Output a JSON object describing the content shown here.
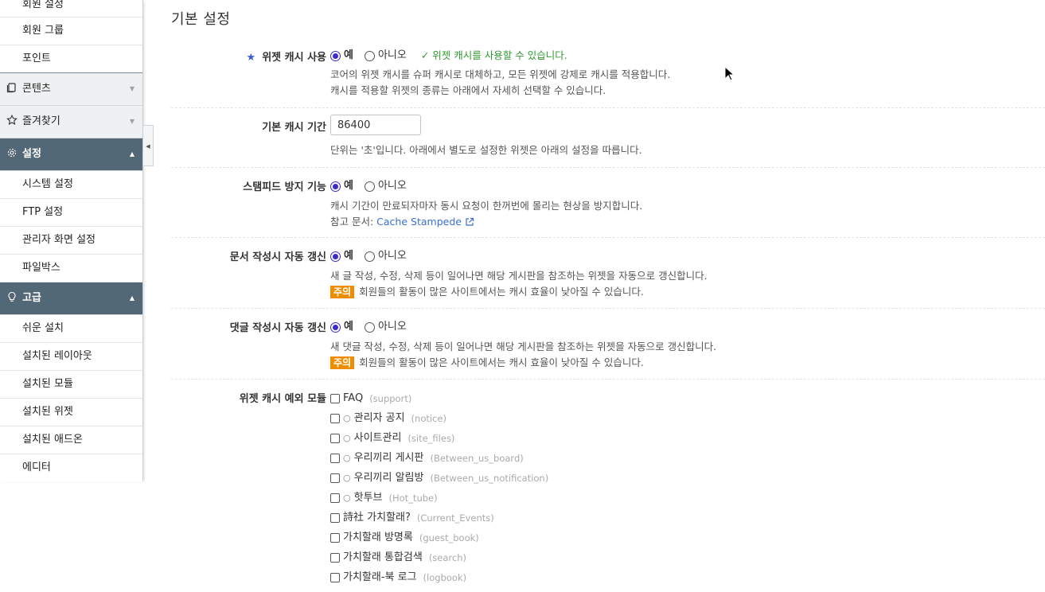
{
  "sidebar": {
    "top_items": [
      "회원 설정",
      "회원 그룹",
      "포인트"
    ],
    "groups": [
      {
        "label": "콘텐츠",
        "icon": "document-icon",
        "active": false
      },
      {
        "label": "즐겨찾기",
        "icon": "star-icon",
        "active": false
      },
      {
        "label": "설정",
        "icon": "gear-icon",
        "active": true,
        "items": [
          "시스템 설정",
          "FTP 설정",
          "관리자 화면 설정",
          "파일박스"
        ]
      },
      {
        "label": "고급",
        "icon": "bulb-icon",
        "active": true,
        "items": [
          "쉬운 설치",
          "설치된 레이아웃",
          "설치된 모듈",
          "설치된 위젯",
          "설치된 애드온",
          "에디터"
        ]
      }
    ]
  },
  "main": {
    "section_title": "기본 설정",
    "widget_cache": {
      "label": "위젯 캐시 사용",
      "yes": "예",
      "no": "아니오",
      "ok_message": "✓ 위젯 캐시를 사용할 수 있습니다.",
      "desc1": "코어의 위젯 캐시를 슈퍼 캐시로 대체하고, 모든 위젯에 강제로 캐시를 적용합니다.",
      "desc2": "캐시를 적용할 위젯의 종류는 아래에서 자세히 선택할 수 있습니다."
    },
    "cache_duration": {
      "label": "기본 캐시 기간",
      "value": "86400",
      "desc": "단위는 '초'입니다. 아래에서 별도로 설정한 위젯은 아래의 설정을 따릅니다."
    },
    "stampede": {
      "label": "스탬피드 방지 기능",
      "yes": "예",
      "no": "아니오",
      "desc": "캐시 기간이 만료되자마자 동시 요청이 한꺼번에 몰리는 현상을 방지합니다.",
      "ref_prefix": "참고 문서: ",
      "ref_link": "Cache Stampede"
    },
    "doc_refresh": {
      "label": "문서 작성시 자동 갱신",
      "yes": "예",
      "no": "아니오",
      "desc": "새 글 작성, 수정, 삭제 등이 일어나면 해당 게시판을 참조하는 위젯을 자동으로 갱신합니다.",
      "badge": "주의",
      "warning": "회원들의 활동이 많은 사이트에서는 캐시 효율이 낮아질 수 있습니다."
    },
    "comment_refresh": {
      "label": "댓글 작성시 자동 갱신",
      "yes": "예",
      "no": "아니오",
      "desc": "새 댓글 작성, 수정, 삭제 등이 일어나면 해당 게시판을 참조하는 위젯을 자동으로 갱신합니다.",
      "badge": "주의",
      "warning": "회원들의 활동이 많은 사이트에서는 캐시 효율이 낮아질 수 있습니다."
    },
    "exclude_modules": {
      "label": "위젯 캐시 예외 모듈",
      "modules": [
        {
          "prefix": "",
          "name": "FAQ",
          "mid": "(support)"
        },
        {
          "prefix": "○",
          "name": "관리자 공지",
          "mid": "(notice)"
        },
        {
          "prefix": "○",
          "name": "사이트관리",
          "mid": "(site_files)"
        },
        {
          "prefix": "○",
          "name": "우리끼리 게시판",
          "mid": "(Between_us_board)"
        },
        {
          "prefix": "○",
          "name": "우리끼리 알림방",
          "mid": "(Between_us_notification)"
        },
        {
          "prefix": "○",
          "name": "핫투브",
          "mid": "(Hot_tube)"
        },
        {
          "prefix": "",
          "name": "詩社 가치할래?",
          "mid": "(Current_Events)"
        },
        {
          "prefix": "",
          "name": "가치할래 방명록",
          "mid": "(guest_book)"
        },
        {
          "prefix": "",
          "name": "가치할래 통합검색",
          "mid": "(search)"
        },
        {
          "prefix": "",
          "name": "가치할래-북 로그",
          "mid": "(logbook)"
        }
      ]
    }
  },
  "colors": {
    "accent": "#3b2cc7",
    "active_group": "#536876",
    "ok": "#2f9a2f",
    "warning_badge": "#f08c00",
    "link": "#3a6fd0"
  }
}
